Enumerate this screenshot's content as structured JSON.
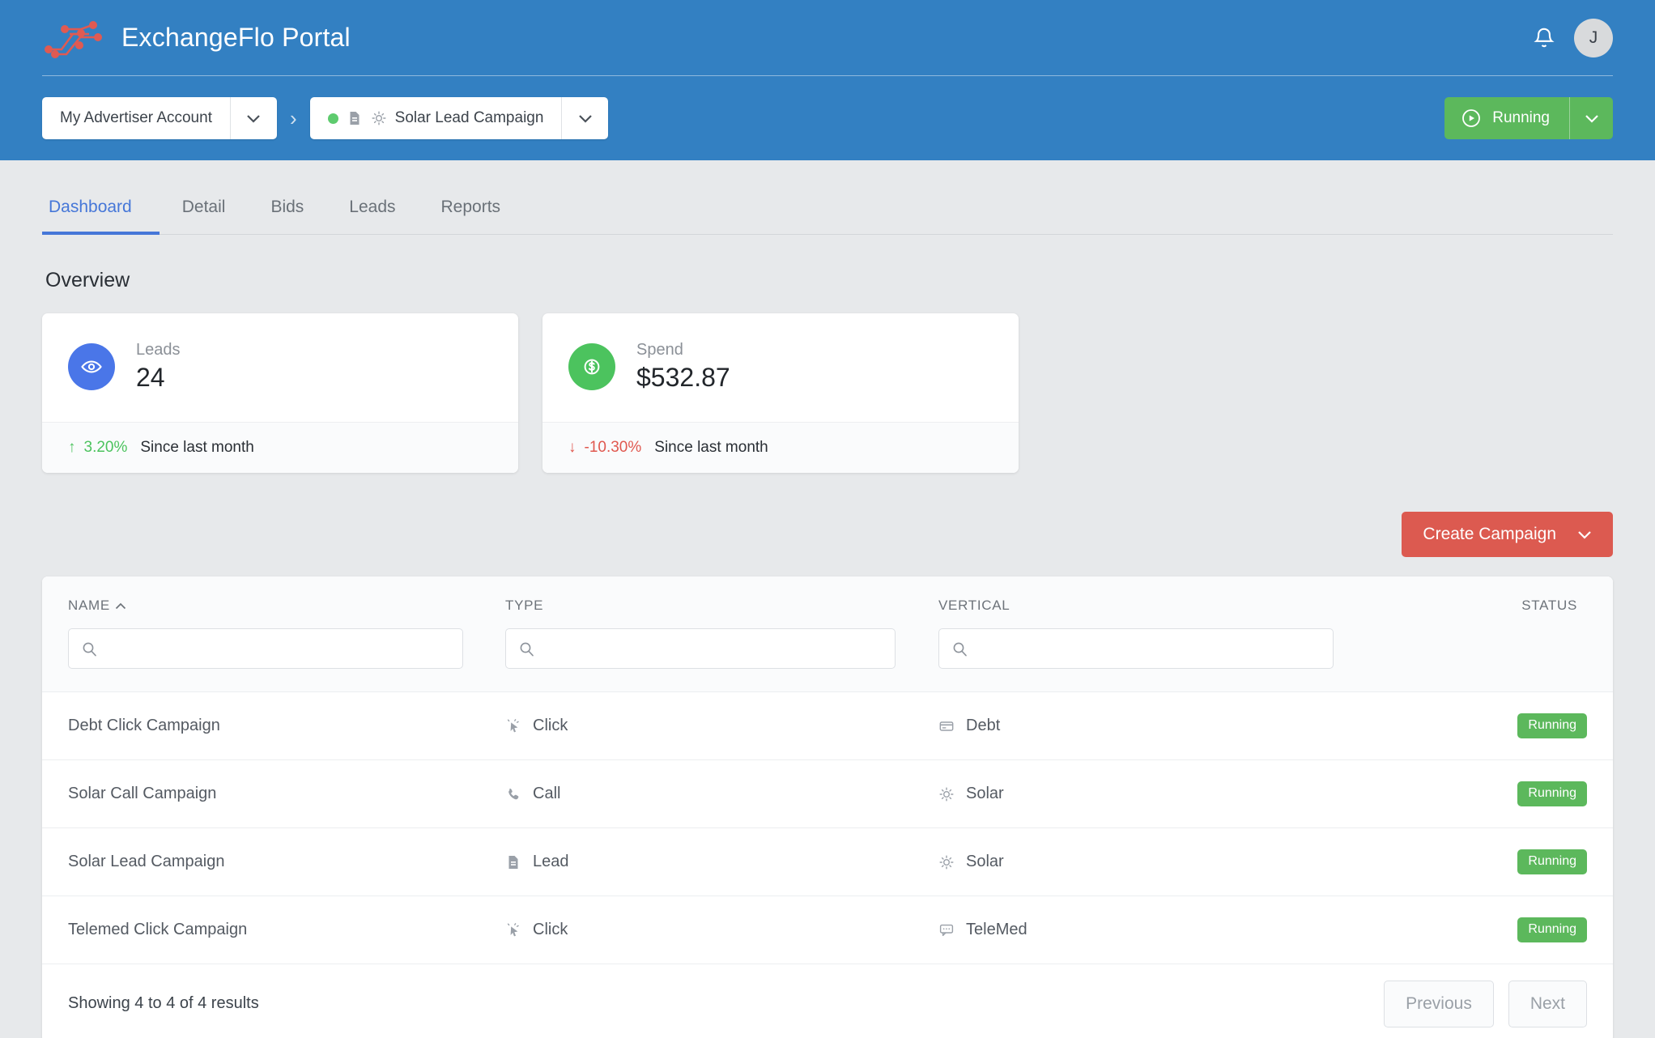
{
  "header": {
    "title": "ExchangeFlo Portal",
    "logo_icon": "circuit-network-logo",
    "brand_color": "#3380c2",
    "logo_color": "#e05a52",
    "bell_icon": "bell-icon",
    "avatar_initial": "J"
  },
  "breadcrumb": {
    "account": {
      "label": "My Advertiser Account",
      "caret_icon": "chevron-down-icon"
    },
    "separator": "›",
    "campaign": {
      "label": "Solar Lead Campaign",
      "status_dot": "green-dot-icon",
      "type_icon": "lead-document-icon",
      "vertical_icon": "sun-icon",
      "caret_icon": "chevron-down-icon"
    }
  },
  "status_button": {
    "label": "Running",
    "icon": "play-circle-icon",
    "caret_icon": "chevron-down-icon",
    "color": "#5cb85c"
  },
  "tabs": [
    {
      "label": "Dashboard",
      "active": true
    },
    {
      "label": "Detail",
      "active": false
    },
    {
      "label": "Bids",
      "active": false
    },
    {
      "label": "Leads",
      "active": false
    },
    {
      "label": "Reports",
      "active": false
    }
  ],
  "overview": {
    "title": "Overview",
    "cards": [
      {
        "label": "Leads",
        "value": "24",
        "icon": "eye-icon",
        "icon_color": "#4a76e8",
        "trend_arrow": "↑",
        "trend_value": "3.20%",
        "trend_direction": "up",
        "trend_color": "#4cc35e",
        "trend_text": "Since last month"
      },
      {
        "label": "Spend",
        "value": "$532.87",
        "icon": "dollar-circle-icon",
        "icon_color": "#4cc35e",
        "trend_arrow": "↓",
        "trend_value": "-10.30%",
        "trend_direction": "down",
        "trend_color": "#e0584f",
        "trend_text": "Since last month"
      }
    ]
  },
  "create_button": {
    "label": "Create Campaign",
    "caret_icon": "chevron-down-icon",
    "color": "#dc5a50"
  },
  "table": {
    "columns": [
      {
        "key": "name",
        "label": "NAME",
        "sort": "asc",
        "sort_icon": "caret-up-icon",
        "has_search": true
      },
      {
        "key": "type",
        "label": "TYPE",
        "has_search": true
      },
      {
        "key": "vertical",
        "label": "VERTICAL",
        "has_search": true
      },
      {
        "key": "status",
        "label": "STATUS",
        "has_search": false
      }
    ],
    "search_placeholder": "",
    "search_icon": "search-icon",
    "rows": [
      {
        "name": "Debt Click Campaign",
        "type": "Click",
        "type_icon": "cursor-click-icon",
        "vertical": "Debt",
        "vertical_icon": "credit-card-icon",
        "status": "Running"
      },
      {
        "name": "Solar Call Campaign",
        "type": "Call",
        "type_icon": "phone-icon",
        "vertical": "Solar",
        "vertical_icon": "sun-icon",
        "status": "Running"
      },
      {
        "name": "Solar Lead Campaign",
        "type": "Lead",
        "type_icon": "document-icon",
        "vertical": "Solar",
        "vertical_icon": "sun-icon",
        "status": "Running"
      },
      {
        "name": "Telemed Click Campaign",
        "type": "Click",
        "type_icon": "cursor-click-icon",
        "vertical": "TeleMed",
        "vertical_icon": "chat-bubble-icon",
        "status": "Running"
      }
    ],
    "footer": {
      "results_text": "Showing 4 to 4 of 4 results",
      "previous_label": "Previous",
      "next_label": "Next"
    }
  }
}
